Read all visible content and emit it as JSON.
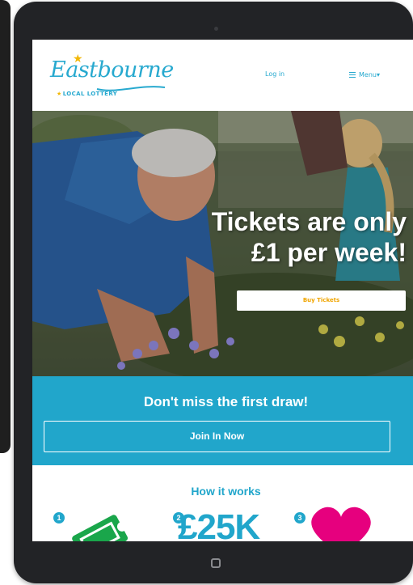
{
  "header": {
    "logo_script": "Eastbourne",
    "logo_sub": "LOCAL LOTTERY",
    "login_label": "Log in",
    "menu_label": "Menu",
    "menu_caret": "▾"
  },
  "hero": {
    "title_line1": "Tickets are only",
    "title_line2": "£1 per week!",
    "buy_label": "Buy Tickets"
  },
  "cta": {
    "title": "Don't miss the first draw!",
    "join_label": "Join In Now"
  },
  "how_it_works": {
    "title": "How it works",
    "steps": [
      {
        "number": "1",
        "icon": "ticket-icon"
      },
      {
        "number": "2",
        "value": "£25K"
      },
      {
        "number": "3",
        "icon": "heart-icon"
      }
    ]
  },
  "colors": {
    "brand_blue": "#21a6cb",
    "accent_yellow": "#f0a500",
    "ticket_green": "#1aa64b",
    "heart_pink": "#e6007e",
    "device_frame": "#222326"
  }
}
